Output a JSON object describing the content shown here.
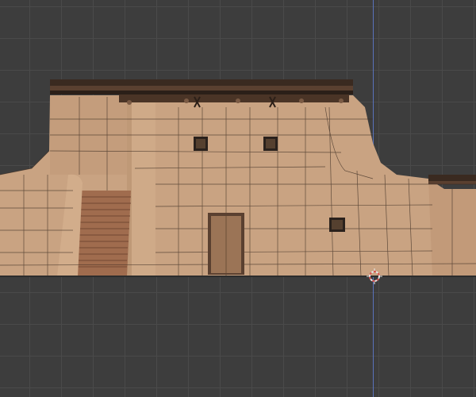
{
  "viewport": {
    "background_color": "#3d3d3d",
    "grid_color": "#4a4a4a",
    "axis_color": "#5c78c9"
  },
  "model": {
    "type": "adobe-building-wireframe",
    "wall_color": "#c9a382",
    "wall_shadow_color": "#b08866",
    "roof_beam_color": "#3a2a20",
    "wire_color": "#3b2c22",
    "stairs_color": "#a06c4e",
    "door_color": "#9b7456",
    "window_color": "#2a211c"
  },
  "icons": {
    "origin": "3d-cursor-icon"
  }
}
